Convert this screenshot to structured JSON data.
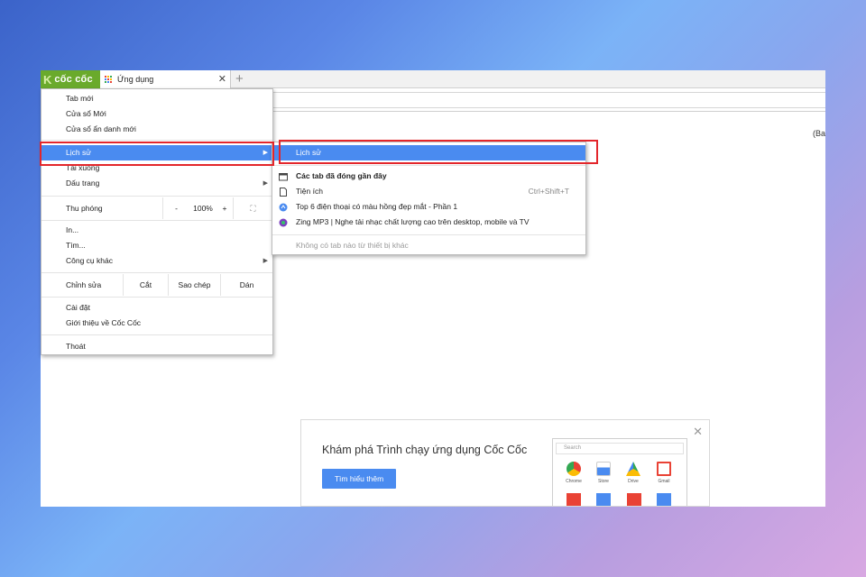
{
  "brand": {
    "name": "cốc cốc",
    "mark": "K"
  },
  "tab": {
    "title": "Ứng dụng",
    "close": "✕",
    "new_tab": "+"
  },
  "page_side_text": "(Ba",
  "menu": {
    "new_tab": "Tab mới",
    "new_window": "Cửa sổ Mới",
    "incognito": "Cửa sổ ẩn danh mới",
    "history": "Lịch sử",
    "downloads": "Tải xuống",
    "bookmarks": "Dấu trang",
    "zoom_label": "Thu phóng",
    "zoom_minus": "-",
    "zoom_value": "100%",
    "zoom_plus": "+",
    "fullscreen": "⛶",
    "print": "In...",
    "find": "Tìm...",
    "more_tools": "Công cụ khác",
    "edit_label": "Chỉnh sửa",
    "cut": "Cắt",
    "copy": "Sao chép",
    "paste": "Dán",
    "settings": "Cài đặt",
    "about": "Giới thiệu về Cốc Cốc",
    "exit": "Thoát",
    "arrow": "▶"
  },
  "submenu": {
    "history": "Lịch sử",
    "recent_tabs": "Các tab đã đóng gần đây",
    "extensions": "Tiện ích",
    "extensions_shortcut": "Ctrl+Shift+T",
    "item_1": "Top 6 điện thoại có màu hồng đẹp mắt - Phần 1",
    "item_2": "Zing MP3 | Nghe tải nhạc chất lượng cao trên desktop, mobile và TV",
    "no_devices": "Không có tab nào từ thiết bị khác"
  },
  "promo": {
    "title": "Khám phá Trình chạy ứng dụng Cốc Cốc",
    "button": "Tìm hiểu thêm",
    "close": "✕",
    "search_placeholder": "Search",
    "apps": [
      "Chrome",
      "Store",
      "Drive",
      "Gmail"
    ]
  },
  "colors": {
    "accent": "#4a8bf0",
    "highlight_box": "#e3262b",
    "brand": "#6aaa2c"
  }
}
